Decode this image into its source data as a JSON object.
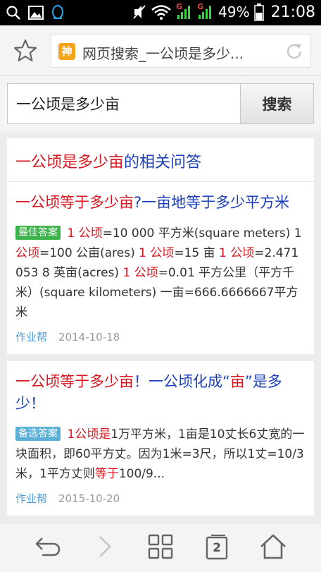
{
  "status_bar": {
    "battery_percent": "49%",
    "time": "21:08",
    "signal_label_1": "G",
    "signal_label_2": "G",
    "icons": [
      "search-icon",
      "image-icon",
      "qq-icon",
      "mute-icon",
      "wifi-icon",
      "signal-icon",
      "signal-icon",
      "battery-icon"
    ]
  },
  "url_bar": {
    "site_logo_text": "神",
    "page_title": "网页搜索_一公顷是多少..."
  },
  "search": {
    "query": "一公顷是多少亩",
    "button_label": "搜索"
  },
  "section": {
    "head_red": "一公顷是多少亩",
    "head_blue": "的相关问答"
  },
  "results": [
    {
      "title_red": "一公顷等于多少亩",
      "title_blue": "?一亩地等于多少平方米",
      "badge": "最佳答案",
      "body": [
        {
          "t": " 1 公顷",
          "hl": true
        },
        {
          "t": "=10 000 平方米(square meters) 1 ",
          "hl": false
        },
        {
          "t": "公顷",
          "hl": true
        },
        {
          "t": "=100 公亩(ares) ",
          "hl": false
        },
        {
          "t": "1 公顷",
          "hl": true
        },
        {
          "t": "=15 亩 ",
          "hl": false
        },
        {
          "t": "1 公顷",
          "hl": true
        },
        {
          "t": "=2.471 053 8 英亩(acres) ",
          "hl": false
        },
        {
          "t": "1 公顷",
          "hl": true
        },
        {
          "t": "=0.01 平方公里（平方千米）(square kilometers) 一亩=666.6666667平方米",
          "hl": false
        }
      ],
      "source": "作业帮",
      "date": "2014-10-18"
    },
    {
      "title_red": "一公顷等于多少亩",
      "title_blue": "！一公顷化成“",
      "title_red2": "亩",
      "title_blue2": "”是多少！",
      "badge": "备选答案",
      "body": [
        {
          "t": " 1公顷",
          "hl": true
        },
        {
          "t": "是",
          "hl": false
        },
        {
          "t": "1万平方米，1亩是10丈长6丈宽的一块面积，即60平方丈。因为1米=3尺，所以1丈=10/3米，1平方丈则",
          "hl": false
        },
        {
          "t": "等于",
          "hl": true
        },
        {
          "t": "100/9...",
          "hl": false
        }
      ],
      "source": "作业帮",
      "date": "2015-10-20"
    }
  ],
  "bottom_nav": {
    "tab_count": "2"
  }
}
